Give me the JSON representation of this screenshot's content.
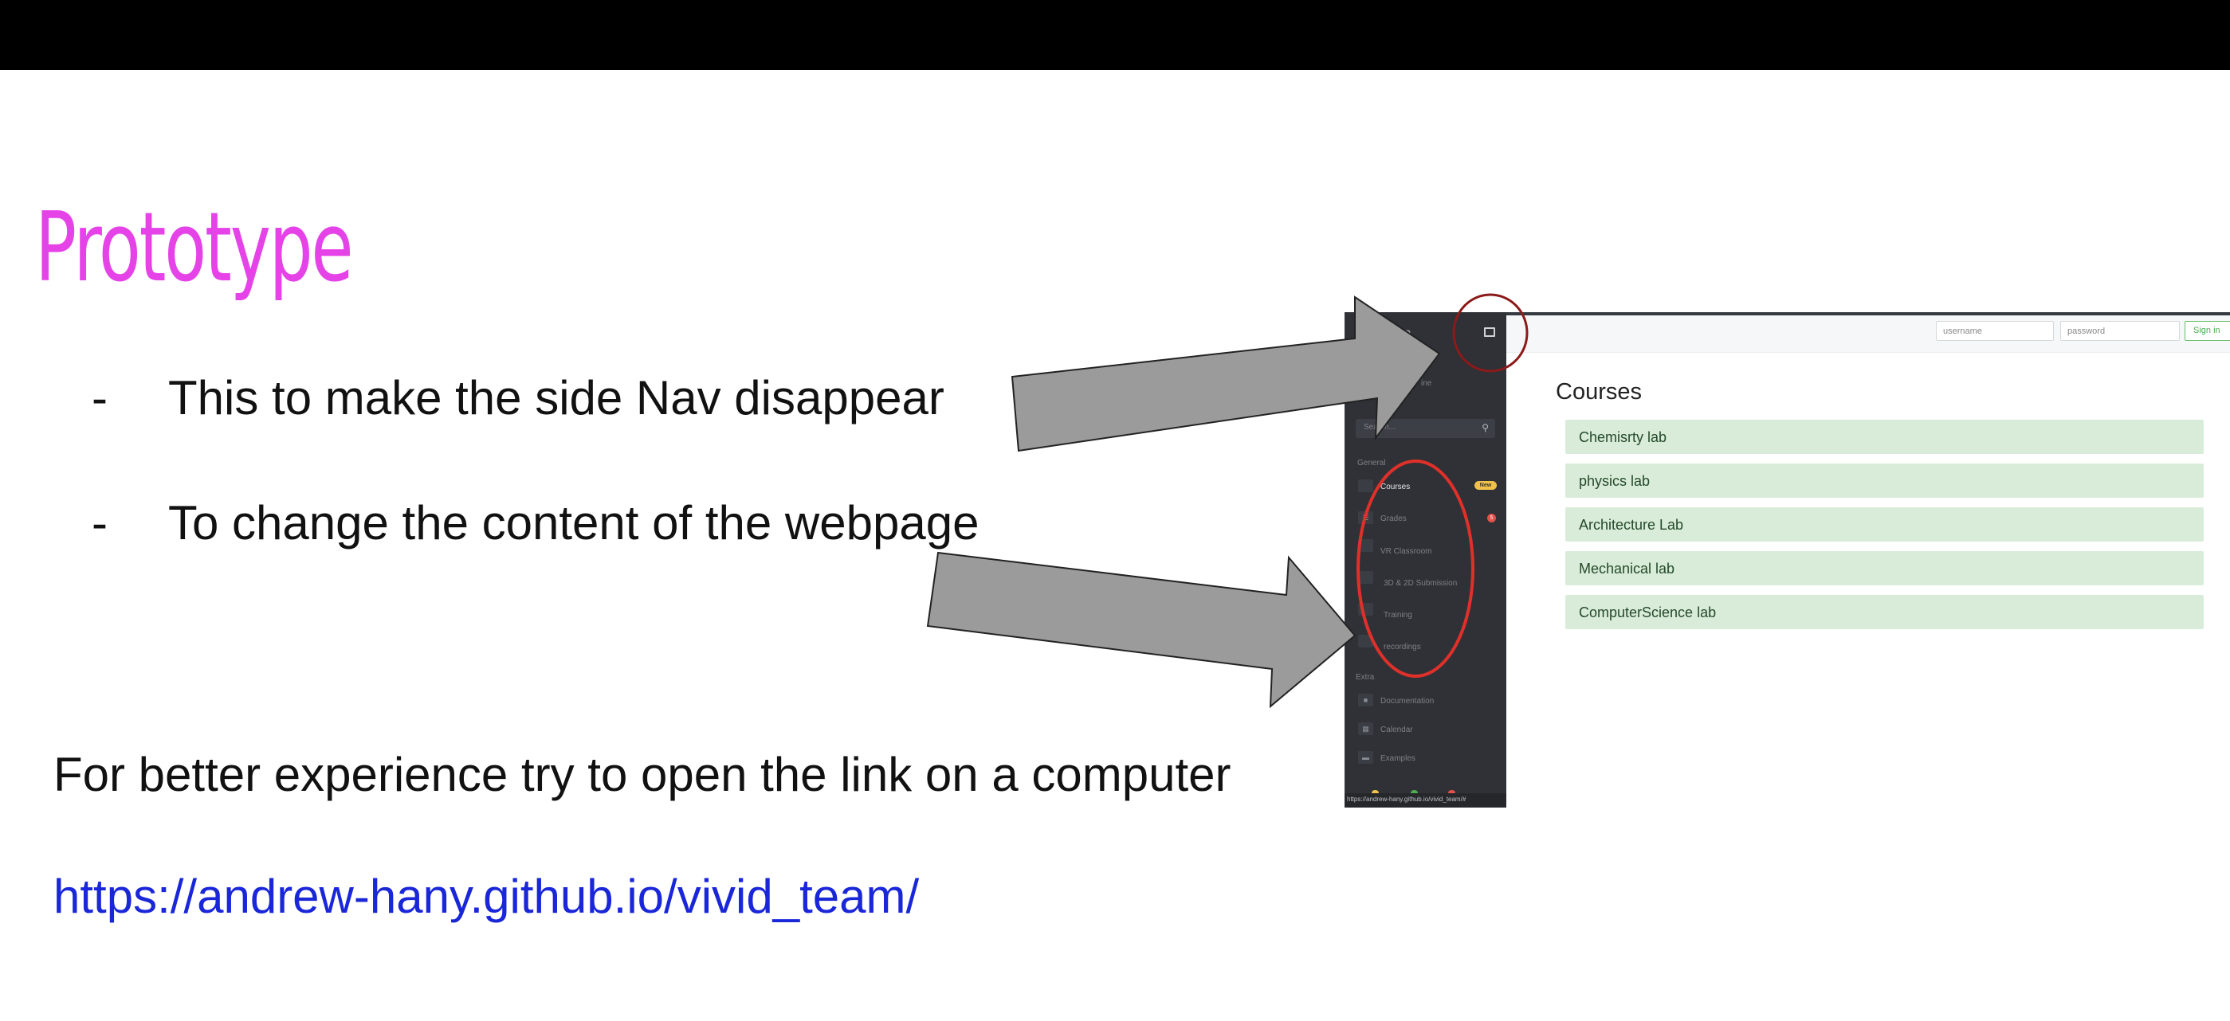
{
  "slide": {
    "title": "Prototype",
    "bullets": [
      {
        "dash": "-",
        "text": "This to make the side Nav disappear"
      },
      {
        "dash": "-",
        "text": "To change the content of the webpage"
      }
    ],
    "note": "For better experience try to open the link on a computer",
    "link": "https://andrew-hany.github.io/vivid_team/"
  },
  "colors": {
    "title": "#e543e8",
    "link": "#1a27d9",
    "arrow_fill": "#9b9b9b",
    "circle_dark": "#8b1a1a",
    "circle_red": "#e0302a"
  },
  "screenshot": {
    "sidebar": {
      "brand": "DAR",
      "user": "am",
      "role": "ine",
      "search_placeholder": "Search...",
      "search_icon": "search-icon",
      "sections": {
        "general": "General",
        "extra": "Extra"
      },
      "items": [
        {
          "label": "Courses",
          "badge": "New",
          "active": true
        },
        {
          "label": "Grades",
          "badge": "5"
        },
        {
          "label": "VR Classroom"
        },
        {
          "label": "3D & 2D Submission"
        },
        {
          "label": "Training"
        },
        {
          "label": "recordings"
        }
      ],
      "extra_items": [
        {
          "label": "Documentation",
          "icon": "book-icon"
        },
        {
          "label": "Calendar",
          "icon": "calendar-icon"
        },
        {
          "label": "Examples",
          "icon": "folder-icon"
        }
      ],
      "status_url": "https://andrew-hany.github.io/vivid_team/#"
    },
    "topnav": {
      "username_placeholder": "username",
      "password_placeholder": "password",
      "signin_label": "Sign in"
    },
    "main": {
      "title": "Courses",
      "courses": [
        "Chemisrty lab",
        "physics lab",
        "Architecture Lab",
        "Mechanical lab",
        "ComputerScience lab"
      ]
    }
  }
}
